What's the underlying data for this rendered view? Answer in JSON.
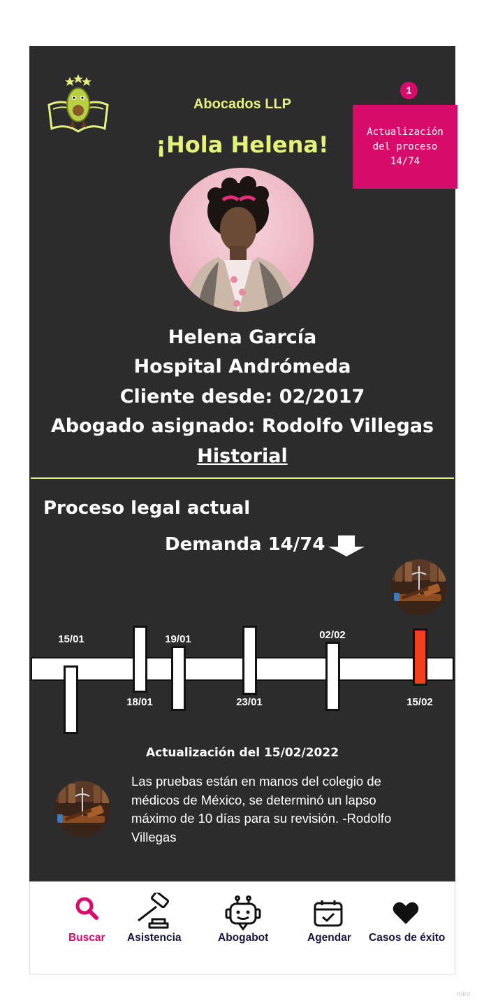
{
  "header": {
    "brand": "Abocados LLP",
    "greeting": "¡Hola Helena!"
  },
  "notification": {
    "count": "1",
    "lines": [
      "Actualización",
      "del proceso",
      "14/74"
    ]
  },
  "profile": {
    "name": "Helena García",
    "organization": "Hospital Andrómeda",
    "client_since": "Cliente desde: 02/2017",
    "lawyer": "Abogado asignado: Rodolfo Villegas",
    "history_link": "Historial"
  },
  "process": {
    "section_title": "Proceso legal actual",
    "case_title": "Demanda 14/74",
    "timeline": [
      {
        "date": "15/01"
      },
      {
        "date": "18/01"
      },
      {
        "date": "19/01"
      },
      {
        "date": "23/01"
      },
      {
        "date": "02/02"
      },
      {
        "date": "15/02",
        "active": true
      }
    ]
  },
  "update": {
    "title": "Actualización del 15/02/2022",
    "body": "Las pruebas están en manos del colegio de médicos de México, se determinó un lapso máximo de 10 días para su revisión. -Rodolfo Villegas"
  },
  "nav": {
    "items": [
      {
        "label": "Buscar",
        "icon": "search-icon",
        "active": true
      },
      {
        "label": "Asistencia",
        "icon": "gavel-icon"
      },
      {
        "label": "Abogabot",
        "icon": "robot-icon"
      },
      {
        "label": "Agendar",
        "icon": "calendar-icon"
      },
      {
        "label": "Casos de éxito",
        "icon": "heart-icon"
      }
    ]
  },
  "watermark": "miro",
  "colors": {
    "background": "#2c2c2c",
    "accent_lime": "#e4f27c",
    "accent_pink": "#d80a6a",
    "timeline_active": "#f0401e",
    "nav_text": "#17163d"
  }
}
